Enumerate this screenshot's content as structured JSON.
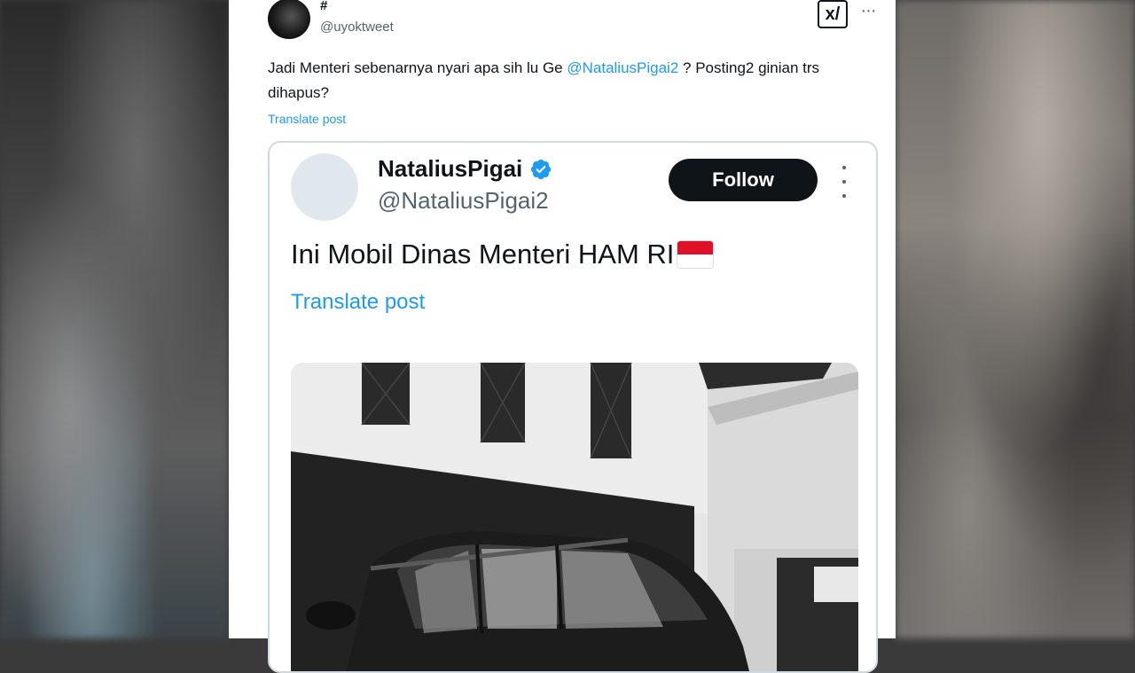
{
  "outer_post": {
    "display_name": "#",
    "handle": "@uyoktweet",
    "grok_label": "x/",
    "more_label": "···",
    "text_before": "Jadi Menteri sebenarnya nyari apa sih lu Ge ",
    "mention": "@NataliusPigai2",
    "text_after": " ? Posting2 ginian trs dihapus?",
    "translate_label": "Translate post"
  },
  "quoted_post": {
    "display_name": "NataliusPigai",
    "handle": "@NataliusPigai2",
    "follow_label": "Follow",
    "text": "Ini Mobil Dinas Menteri HAM RI",
    "translate_label": "Translate post"
  },
  "colors": {
    "link": "#1d9bf0",
    "text": "#0f1419",
    "secondary": "#536471",
    "follow_bg": "#0f1419"
  }
}
